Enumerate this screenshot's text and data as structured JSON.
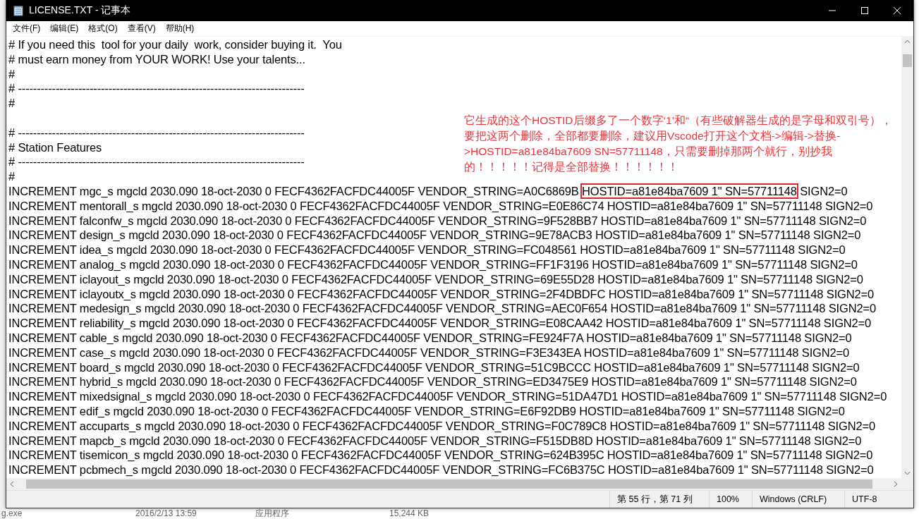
{
  "window": {
    "title": "LICENSE.TXT - 记事本"
  },
  "menu": [
    {
      "label": "文件(F)"
    },
    {
      "label": "编辑(E)"
    },
    {
      "label": "格式(O)"
    },
    {
      "label": "查看(V)"
    },
    {
      "label": "帮助(H)"
    }
  ],
  "blocks": [
    [
      {
        "text": "# If you need this  tool for your daily  work, consider buying it.  You"
      },
      {
        "text": "# must earn money from YOUR WORK! Use your talents..."
      },
      {
        "text": "#"
      },
      {
        "text": "# ----------------------------------------------------------------------------"
      },
      {
        "text": "#"
      }
    ],
    [
      {
        "text": "# ----------------------------------------------------------------------------"
      },
      {
        "text": "# Station Features"
      },
      {
        "text": "# ----------------------------------------------------------------------------"
      },
      {
        "text": "#"
      },
      {
        "parts": [
          {
            "text": "INCREMENT mgc_s mgcld 2030.090 18-oct-2030 0 FECF4362FACFDC44005F VENDOR_STRING=A0C6869B ",
            "boxed": false
          },
          {
            "text": "HOSTID=a81e84ba7609 1\" SN=57711148",
            "boxed": true
          },
          {
            "text": " SIGN2=0",
            "boxed": false
          }
        ]
      },
      {
        "text": "INCREMENT mentorall_s mgcld 2030.090 18-oct-2030 0 FECF4362FACFDC44005F VENDOR_STRING=E0E86C74 HOSTID=a81e84ba7609 1\" SN=57711148 SIGN2=0"
      },
      {
        "text": "INCREMENT falconfw_s mgcld 2030.090 18-oct-2030 0 FECF4362FACFDC44005F VENDOR_STRING=9F528BB7 HOSTID=a81e84ba7609 1\" SN=57711148 SIGN2=0"
      },
      {
        "text": "INCREMENT design_s mgcld 2030.090 18-oct-2030 0 FECF4362FACFDC44005F VENDOR_STRING=9E78ACB3 HOSTID=a81e84ba7609 1\" SN=57711148 SIGN2=0"
      },
      {
        "text": "INCREMENT idea_s mgcld 2030.090 18-oct-2030 0 FECF4362FACFDC44005F VENDOR_STRING=FC048561 HOSTID=a81e84ba7609 1\" SN=57711148 SIGN2=0"
      },
      {
        "text": "INCREMENT analog_s mgcld 2030.090 18-oct-2030 0 FECF4362FACFDC44005F VENDOR_STRING=FF1F3196 HOSTID=a81e84ba7609 1\" SN=57711148 SIGN2=0"
      },
      {
        "text": "INCREMENT iclayout_s mgcld 2030.090 18-oct-2030 0 FECF4362FACFDC44005F VENDOR_STRING=69E55D28 HOSTID=a81e84ba7609 1\" SN=57711148 SIGN2=0"
      },
      {
        "text": "INCREMENT iclayoutx_s mgcld 2030.090 18-oct-2030 0 FECF4362FACFDC44005F VENDOR_STRING=2F4DBDFC HOSTID=a81e84ba7609 1\" SN=57711148 SIGN2=0"
      },
      {
        "text": "INCREMENT medesign_s mgcld 2030.090 18-oct-2030 0 FECF4362FACFDC44005F VENDOR_STRING=AEC0F654 HOSTID=a81e84ba7609 1\" SN=57711148 SIGN2=0"
      },
      {
        "text": "INCREMENT reliability_s mgcld 2030.090 18-oct-2030 0 FECF4362FACFDC44005F VENDOR_STRING=E08CAA42 HOSTID=a81e84ba7609 1\" SN=57711148 SIGN2=0"
      },
      {
        "text": "INCREMENT cable_s mgcld 2030.090 18-oct-2030 0 FECF4362FACFDC44005F VENDOR_STRING=FE924F7A HOSTID=a81e84ba7609 1\" SN=57711148 SIGN2=0"
      },
      {
        "text": "INCREMENT case_s mgcld 2030.090 18-oct-2030 0 FECF4362FACFDC44005F VENDOR_STRING=F3E343EA HOSTID=a81e84ba7609 1\" SN=57711148 SIGN2=0"
      },
      {
        "text": "INCREMENT board_s mgcld 2030.090 18-oct-2030 0 FECF4362FACFDC44005F VENDOR_STRING=51C9BCCC HOSTID=a81e84ba7609 1\" SN=57711148 SIGN2=0"
      },
      {
        "text": "INCREMENT hybrid_s mgcld 2030.090 18-oct-2030 0 FECF4362FACFDC44005F VENDOR_STRING=ED3475E9 HOSTID=a81e84ba7609 1\" SN=57711148 SIGN2=0"
      },
      {
        "text": "INCREMENT mixedsignal_s mgcld 2030.090 18-oct-2030 0 FECF4362FACFDC44005F VENDOR_STRING=51DA47D1 HOSTID=a81e84ba7609 1\" SN=57711148 SIGN2=0"
      },
      {
        "text": "INCREMENT edif_s mgcld 2030.090 18-oct-2030 0 FECF4362FACFDC44005F VENDOR_STRING=E6F92DB9 HOSTID=a81e84ba7609 1\" SN=57711148 SIGN2=0"
      },
      {
        "text": "INCREMENT accuparts_s mgcld 2030.090 18-oct-2030 0 FECF4362FACFDC44005F VENDOR_STRING=F0C789C8 HOSTID=a81e84ba7609 1\" SN=57711148 SIGN2=0"
      },
      {
        "text": "INCREMENT mapcb_s mgcld 2030.090 18-oct-2030 0 FECF4362FACFDC44005F VENDOR_STRING=F515DB8D HOSTID=a81e84ba7609 1\" SN=57711148 SIGN2=0"
      },
      {
        "text": "INCREMENT tisemicon_s mgcld 2030.090 18-oct-2030 0 FECF4362FACFDC44005F VENDOR_STRING=624B395C HOSTID=a81e84ba7609 1\" SN=57711148 SIGN2=0"
      },
      {
        "text": "INCREMENT pcbmech_s mgcld 2030.090 18-oct-2030 0 FECF4362FACFDC44005F VENDOR_STRING=FC6B375C HOSTID=a81e84ba7609 1\" SN=57711148 SIGN2=0"
      }
    ]
  ],
  "annotation": "它生成的这个HOSTID后缀多了一个数字‘1’和“（有些破解器生成的是字母和双引号），要把这两个删除，全部都要删除，建议用Vscode打开这个文档->编辑->替换->HOSTID=a81e84ba7609 SN=57711148，只需要删掉那两个就行，别抄我的！！！！！记得是全部替换！！！！！！",
  "status_bar": [
    {
      "text": "第 55 行，第 71 列"
    },
    {
      "text": "100%"
    },
    {
      "text": "Windows (CRLF)"
    },
    {
      "text": "UTF-8"
    }
  ],
  "background_row": {
    "name": "g.exe",
    "date": "2016/2/13 13:59",
    "type": "应用程序",
    "size": "15,244 KB"
  }
}
